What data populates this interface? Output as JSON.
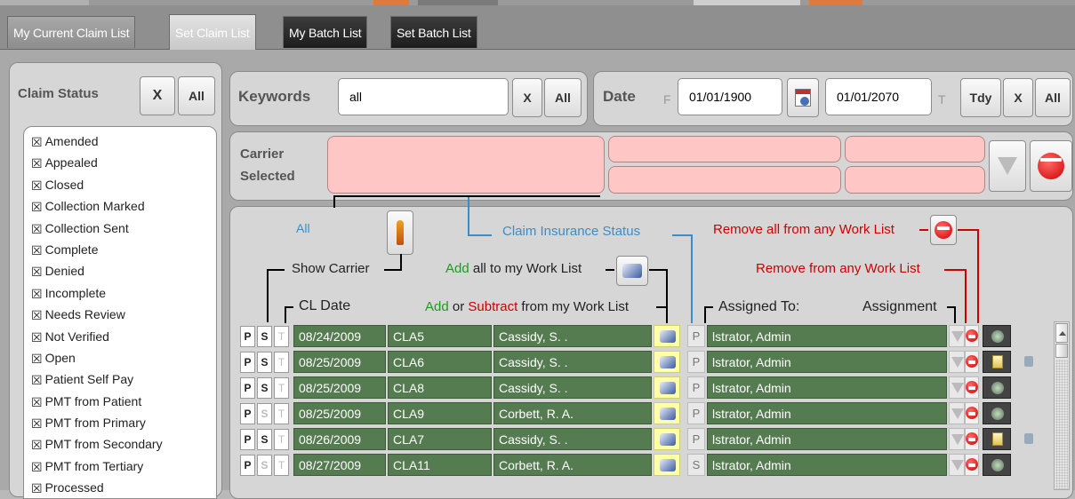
{
  "tabs": [
    {
      "label": "My Current Claim List"
    },
    {
      "label": "Set Claim List"
    },
    {
      "label": "My Batch List"
    },
    {
      "label": "Set Batch List"
    }
  ],
  "claim_status": {
    "title": "Claim Status",
    "clear_label": "X",
    "all_label": "All",
    "items": [
      "Amended",
      "Appealed",
      "Closed",
      "Collection Marked",
      "Collection Sent",
      "Complete",
      "Denied",
      "Incomplete",
      "Needs Review",
      "Not Verified",
      "Open",
      "Patient Self Pay",
      "PMT from Patient",
      "PMT from Primary",
      "PMT from Secondary",
      "PMT from Tertiary",
      "Processed"
    ],
    "checkbox_mark": "☒"
  },
  "keywords": {
    "label": "Keywords",
    "value": "all",
    "clear_label": "X",
    "all_label": "All"
  },
  "date": {
    "label": "Date",
    "from_label": "F",
    "from_value": "01/01/1900",
    "to_value": "01/01/2070",
    "to_label": "T",
    "today_label": "Tdy",
    "clear_label": "X",
    "all_label": "All"
  },
  "carrier": {
    "label_line1": "Carrier",
    "label_line2": "Selected"
  },
  "legend": {
    "all": "All",
    "claim_insurance_status": "Claim Insurance Status",
    "remove_all": "Remove all from any Work List",
    "show_carrier": "Show Carrier",
    "add_all_green": "Add",
    "add_all_rest": " all to my Work List",
    "remove_from_any": "Remove from any Work List",
    "cl_date": "CL Date",
    "add_green": "Add",
    "or": " or ",
    "subtract_red": "Subtract",
    "from_list": " from my Work List",
    "assigned_to": "Assigned To:",
    "assignment": "Assignment"
  },
  "rows": [
    {
      "p": "P",
      "s": "S",
      "s_active": true,
      "t": "T",
      "date": "08/24/2009",
      "claim": "CLA5",
      "name": "Cassidy, S. .",
      "flag": "P",
      "assigned": "lstrator, Admin",
      "paper": false,
      "speaker": false
    },
    {
      "p": "P",
      "s": "S",
      "s_active": true,
      "t": "T",
      "date": "08/25/2009",
      "claim": "CLA6",
      "name": "Cassidy, S. .",
      "flag": "P",
      "assigned": "lstrator, Admin",
      "paper": true,
      "speaker": true
    },
    {
      "p": "P",
      "s": "S",
      "s_active": true,
      "t": "T",
      "date": "08/25/2009",
      "claim": "CLA8",
      "name": "Cassidy, S. .",
      "flag": "P",
      "assigned": "lstrator, Admin",
      "paper": false,
      "speaker": false
    },
    {
      "p": "P",
      "s": "S",
      "s_active": false,
      "t": "T",
      "date": "08/25/2009",
      "claim": "CLA9",
      "name": "Corbett, R. A.",
      "flag": "P",
      "assigned": "lstrator, Admin",
      "paper": false,
      "speaker": false
    },
    {
      "p": "P",
      "s": "S",
      "s_active": true,
      "t": "T",
      "date": "08/26/2009",
      "claim": "CLA7",
      "name": "Cassidy, S. .",
      "flag": "P",
      "assigned": "lstrator, Admin",
      "paper": true,
      "speaker": true
    },
    {
      "p": "P",
      "s": "S",
      "s_active": false,
      "t": "T",
      "date": "08/27/2009",
      "claim": "CLA11",
      "name": "Corbett, R. A.",
      "flag": "S",
      "assigned": "lstrator, Admin",
      "paper": false,
      "speaker": false
    }
  ]
}
